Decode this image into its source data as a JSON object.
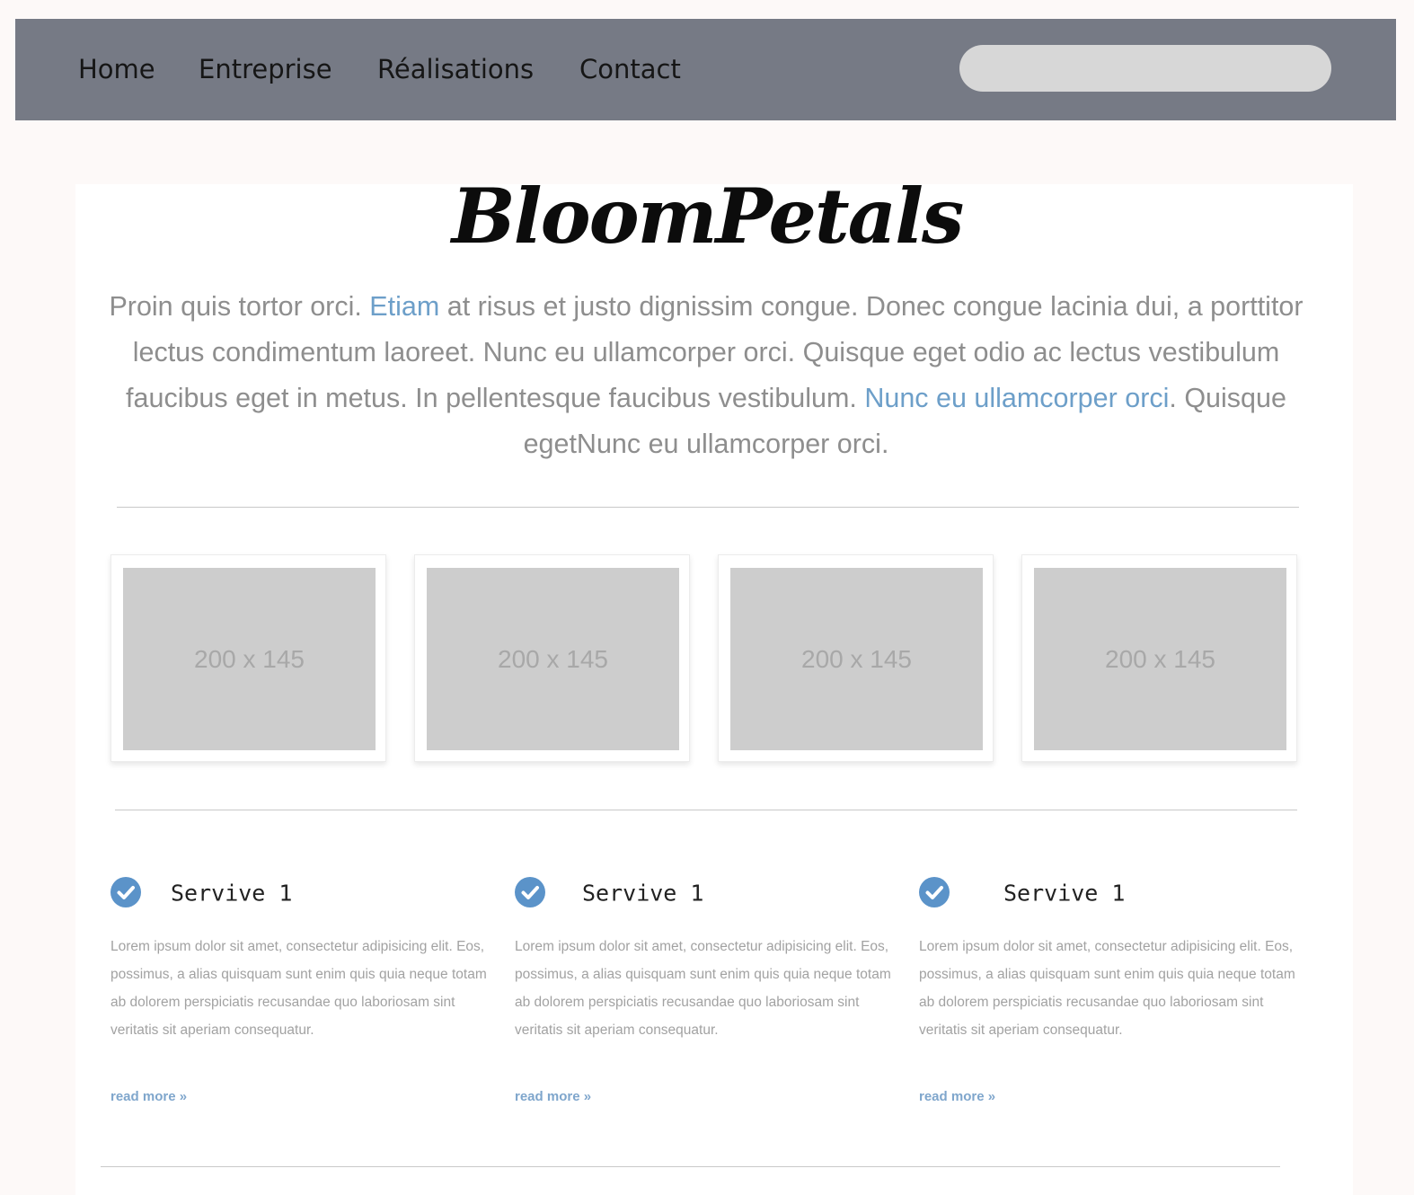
{
  "nav": {
    "items": [
      {
        "label": "Home"
      },
      {
        "label": "Entreprise"
      },
      {
        "label": "Réalisations"
      },
      {
        "label": "Contact"
      }
    ],
    "search_value": ""
  },
  "brand": {
    "name": "BloomPetals"
  },
  "intro": {
    "part1": "Proin quis tortor orci. ",
    "link1": "Etiam",
    "part2": " at risus et justo dignissim congue. Donec congue lacinia dui, a porttitor lectus condimentum laoreet. Nunc eu ullamcorper orci. Quisque eget odio ac lectus vestibulum faucibus eget in metus. In pellentesque faucibus vestibulum. ",
    "link2": "Nunc eu ullamcorper orci",
    "part3": ". Quisque egetNunc eu ullamcorper orci."
  },
  "gallery": {
    "items": [
      {
        "label": "200 x 145"
      },
      {
        "label": "200 x 145"
      },
      {
        "label": "200 x 145"
      },
      {
        "label": "200 x 145"
      }
    ]
  },
  "services": {
    "items": [
      {
        "title": "Servive 1",
        "text": "Lorem ipsum dolor sit amet, consectetur adipisicing elit. Eos, possimus, a alias quisquam sunt enim quis quia neque totam ab dolorem perspiciatis recusandae quo laboriosam sint veritatis sit aperiam consequatur.",
        "link": "read more »"
      },
      {
        "title": "Servive 1",
        "text": "Lorem ipsum dolor sit amet, consectetur adipisicing elit. Eos, possimus, a alias quisquam sunt enim quis quia neque totam ab dolorem perspiciatis recusandae quo laboriosam sint veritatis sit aperiam consequatur.",
        "link": "read more »"
      },
      {
        "title": "Servive 1",
        "text": "Lorem ipsum dolor sit amet, consectetur adipisicing elit. Eos, possimus, a alias quisquam sunt enim quis quia neque totam ab dolorem perspiciatis recusandae quo laboriosam sint veritatis sit aperiam consequatur.",
        "link": "read more »"
      }
    ]
  },
  "colors": {
    "navbar_bg": "#767a85",
    "search_bg": "#d7d7d7",
    "link_blue": "#6d9fc9",
    "check_blue": "#5b93c9",
    "placeholder_gray": "#cdcdcd"
  }
}
